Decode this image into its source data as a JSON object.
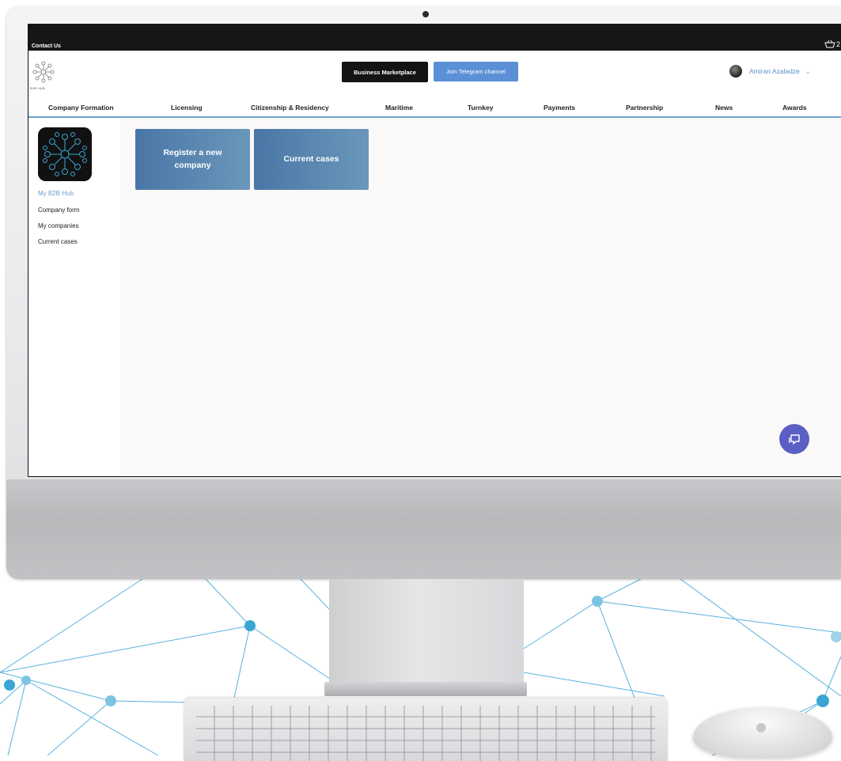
{
  "topbar": {
    "contact_label": "Contact Us",
    "cart_count": "2"
  },
  "header": {
    "logo_text": "B2B HUB",
    "business_marketplace_label": "Business Marketplace",
    "telegram_label": "Join Telegram channel",
    "user_name": "Amiran Azaladze"
  },
  "nav": {
    "items": [
      {
        "label": "Company Formation"
      },
      {
        "label": "Licensing"
      },
      {
        "label": "Citizenship & Residency"
      },
      {
        "label": "Maritime"
      },
      {
        "label": "Turnkey"
      },
      {
        "label": "Payments"
      },
      {
        "label": "Partnership"
      },
      {
        "label": "News"
      },
      {
        "label": "Awards"
      }
    ]
  },
  "sidebar": {
    "items": [
      {
        "label": "My B2B Hub"
      },
      {
        "label": "Company form"
      },
      {
        "label": "My companies"
      },
      {
        "label": "Current cases"
      }
    ]
  },
  "main": {
    "tiles": [
      {
        "label": "Register a new company"
      },
      {
        "label": "Current cases"
      }
    ]
  },
  "colors": {
    "accent": "#5b8fd6",
    "tile": "#4a76a6",
    "chat": "#5a5fc4",
    "network": "#3aa6d6"
  }
}
